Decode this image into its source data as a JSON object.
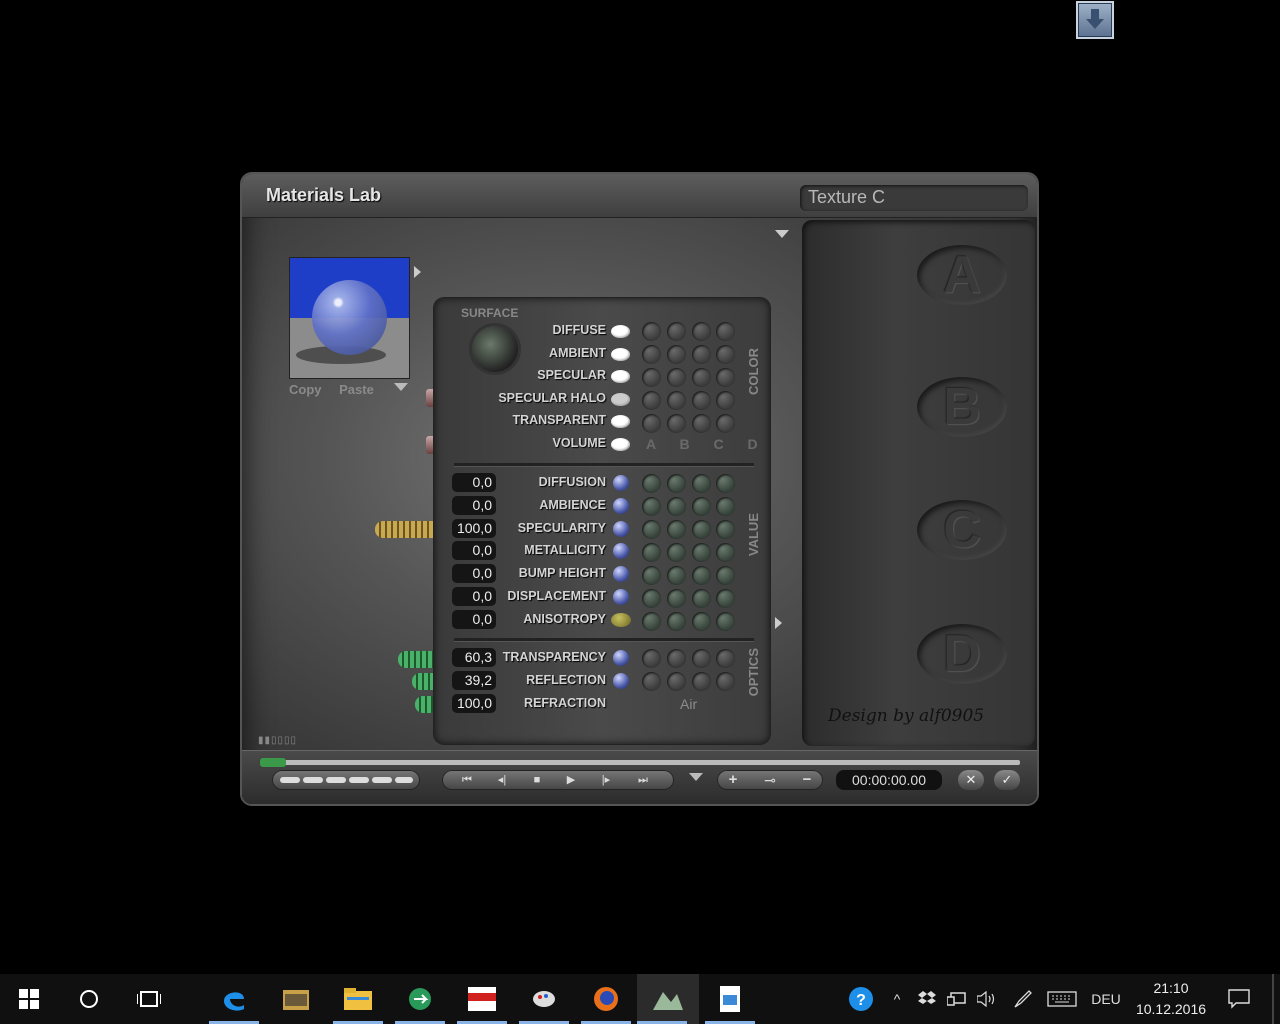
{
  "window": {
    "title": "Materials Lab",
    "texture_name": "Texture C",
    "preview_actions": {
      "copy": "Copy",
      "paste": "Paste"
    },
    "design_credit": "Design by alf0905"
  },
  "surface": {
    "label": "SURFACE",
    "color_rows": [
      {
        "label": "DIFFUSE"
      },
      {
        "label": "AMBIENT"
      },
      {
        "label": "SPECULAR"
      },
      {
        "label": "SPECULAR HALO"
      },
      {
        "label": "TRANSPARENT"
      },
      {
        "label": "VOLUME"
      }
    ],
    "color_columns": "A B C D",
    "value_rows": [
      {
        "label": "DIFFUSION",
        "value": "0,0"
      },
      {
        "label": "AMBIENCE",
        "value": "0,0"
      },
      {
        "label": "SPECULARITY",
        "value": "100,0"
      },
      {
        "label": "METALLICITY",
        "value": "0,0"
      },
      {
        "label": "BUMP HEIGHT",
        "value": "0,0"
      },
      {
        "label": "DISPLACEMENT",
        "value": "0,0"
      },
      {
        "label": "ANISOTROPY",
        "value": "0,0"
      }
    ],
    "optics_rows": [
      {
        "label": "TRANSPARENCY",
        "value": "60,3"
      },
      {
        "label": "REFLECTION",
        "value": "39,2"
      },
      {
        "label": "REFRACTION",
        "value": "100,0"
      }
    ],
    "refraction_medium": "Air",
    "section_labels": {
      "color": "COLOR",
      "value": "VALUE",
      "optics": "OPTICS"
    }
  },
  "slots": {
    "a": "A",
    "b": "B",
    "c": "C",
    "d": "D"
  },
  "toolbar": {
    "time": "00:00:00.00",
    "add": "+",
    "key": "⊸",
    "remove": "−",
    "close": "✕",
    "ok": "✓"
  },
  "taskbar": {
    "language": "DEU",
    "time": "21:10",
    "date": "10.12.2016"
  },
  "colors": {
    "accent_blue": "#1f3ec8",
    "taskbar_bg": "#101010"
  }
}
